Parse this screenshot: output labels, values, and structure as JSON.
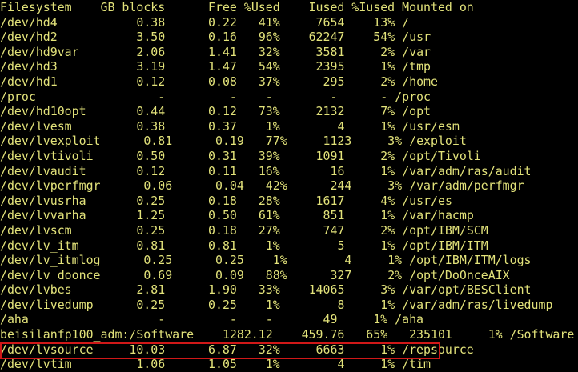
{
  "terminal": {
    "foreground_color": "#e2e27a",
    "background_color": "#000000",
    "highlight_color": "#d01818",
    "highlighted_row": "/dev/lvtim",
    "header": {
      "filesystem": "Filesystem",
      "gb_blocks": "GB blocks",
      "free": "Free",
      "pct_used": "%Used",
      "iused": "Iused",
      "pct_iused": "%Iused",
      "mounted_on": "Mounted on"
    },
    "rows": [
      {
        "filesystem": "/dev/hd4",
        "gb_blocks": "0.38",
        "free": "0.22",
        "pct_used": "41%",
        "iused": "7654",
        "pct_iused": "13%",
        "mounted_on": "/"
      },
      {
        "filesystem": "/dev/hd2",
        "gb_blocks": "3.50",
        "free": "0.16",
        "pct_used": "96%",
        "iused": "62247",
        "pct_iused": "54%",
        "mounted_on": "/usr"
      },
      {
        "filesystem": "/dev/hd9var",
        "gb_blocks": "2.06",
        "free": "1.41",
        "pct_used": "32%",
        "iused": "3581",
        "pct_iused": "2%",
        "mounted_on": "/var"
      },
      {
        "filesystem": "/dev/hd3",
        "gb_blocks": "3.19",
        "free": "1.47",
        "pct_used": "54%",
        "iused": "2395",
        "pct_iused": "1%",
        "mounted_on": "/tmp"
      },
      {
        "filesystem": "/dev/hd1",
        "gb_blocks": "0.12",
        "free": "0.08",
        "pct_used": "37%",
        "iused": "295",
        "pct_iused": "2%",
        "mounted_on": "/home"
      },
      {
        "filesystem": "/proc",
        "gb_blocks": "-",
        "free": "-",
        "pct_used": "-",
        "iused": "-",
        "pct_iused": "-",
        "mounted_on": "/proc"
      },
      {
        "filesystem": "/dev/hd10opt",
        "gb_blocks": "0.44",
        "free": "0.12",
        "pct_used": "73%",
        "iused": "2132",
        "pct_iused": "7%",
        "mounted_on": "/opt"
      },
      {
        "filesystem": "/dev/lvesm",
        "gb_blocks": "0.38",
        "free": "0.37",
        "pct_used": "1%",
        "iused": "4",
        "pct_iused": "1%",
        "mounted_on": "/usr/esm"
      },
      {
        "filesystem": "/dev/lvexploit",
        "gb_blocks": "0.81",
        "free": "0.19",
        "pct_used": "77%",
        "iused": "1123",
        "pct_iused": "3%",
        "mounted_on": "/exploit"
      },
      {
        "filesystem": "/dev/lvtivoli",
        "gb_blocks": "0.50",
        "free": "0.31",
        "pct_used": "39%",
        "iused": "1091",
        "pct_iused": "2%",
        "mounted_on": "/opt/Tivoli"
      },
      {
        "filesystem": "/dev/lvaudit",
        "gb_blocks": "0.12",
        "free": "0.11",
        "pct_used": "16%",
        "iused": "16",
        "pct_iused": "1%",
        "mounted_on": "/var/adm/ras/audit"
      },
      {
        "filesystem": "/dev/lvperfmgr",
        "gb_blocks": "0.06",
        "free": "0.04",
        "pct_used": "42%",
        "iused": "244",
        "pct_iused": "3%",
        "mounted_on": "/var/adm/perfmgr"
      },
      {
        "filesystem": "/dev/lvusrha",
        "gb_blocks": "0.25",
        "free": "0.18",
        "pct_used": "28%",
        "iused": "1617",
        "pct_iused": "4%",
        "mounted_on": "/usr/es"
      },
      {
        "filesystem": "/dev/lvvarha",
        "gb_blocks": "1.25",
        "free": "0.50",
        "pct_used": "61%",
        "iused": "851",
        "pct_iused": "1%",
        "mounted_on": "/var/hacmp"
      },
      {
        "filesystem": "/dev/lvscm",
        "gb_blocks": "0.25",
        "free": "0.18",
        "pct_used": "27%",
        "iused": "747",
        "pct_iused": "2%",
        "mounted_on": "/opt/IBM/SCM"
      },
      {
        "filesystem": "/dev/lv_itm",
        "gb_blocks": "0.81",
        "free": "0.81",
        "pct_used": "1%",
        "iused": "5",
        "pct_iused": "1%",
        "mounted_on": "/opt/IBM/ITM"
      },
      {
        "filesystem": "/dev/lv_itmlog",
        "gb_blocks": "0.25",
        "free": "0.25",
        "pct_used": "1%",
        "iused": "4",
        "pct_iused": "1%",
        "mounted_on": "/opt/IBM/ITM/logs"
      },
      {
        "filesystem": "/dev/lv_doonce",
        "gb_blocks": "0.69",
        "free": "0.09",
        "pct_used": "88%",
        "iused": "327",
        "pct_iused": "2%",
        "mounted_on": "/opt/DoOnceAIX"
      },
      {
        "filesystem": "/dev/lvbes",
        "gb_blocks": "2.81",
        "free": "1.90",
        "pct_used": "33%",
        "iused": "14065",
        "pct_iused": "3%",
        "mounted_on": "/var/opt/BESClient"
      },
      {
        "filesystem": "/dev/livedump",
        "gb_blocks": "0.25",
        "free": "0.25",
        "pct_used": "1%",
        "iused": "8",
        "pct_iused": "1%",
        "mounted_on": "/var/adm/ras/livedump"
      },
      {
        "filesystem": "/aha",
        "gb_blocks": "-",
        "free": "-",
        "pct_used": "-",
        "iused": "49",
        "pct_iused": "1%",
        "mounted_on": "/aha"
      },
      {
        "filesystem": "beisilanfp100_adm:/Software",
        "gb_blocks": "1282.12",
        "free": "459.76",
        "pct_used": "65%",
        "iused": "235101",
        "pct_iused": "1%",
        "mounted_on": "/Software"
      },
      {
        "filesystem": "/dev/lvsource",
        "gb_blocks": "10.03",
        "free": "6.87",
        "pct_used": "32%",
        "iused": "6663",
        "pct_iused": "1%",
        "mounted_on": "/repsource"
      },
      {
        "filesystem": "/dev/lvtim",
        "gb_blocks": "1.06",
        "free": "1.05",
        "pct_used": "1%",
        "iused": "4",
        "pct_iused": "1%",
        "mounted_on": "/tim"
      }
    ]
  }
}
